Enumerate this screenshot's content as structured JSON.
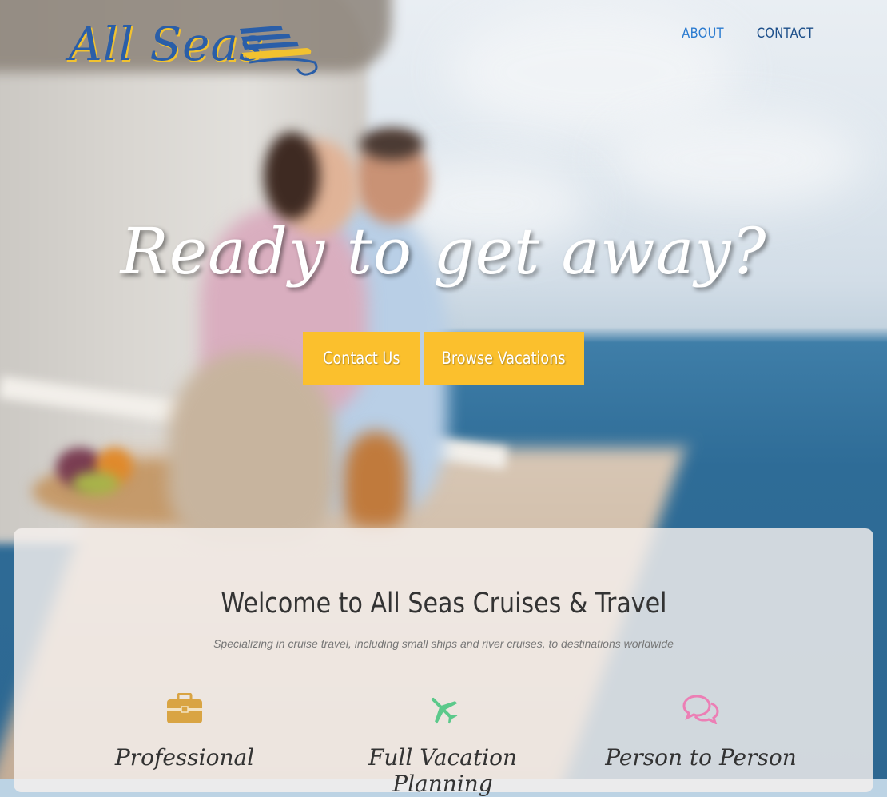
{
  "brand": {
    "logo_text": "All Seas"
  },
  "nav": {
    "items": [
      {
        "label": "ABOUT"
      },
      {
        "label": "CONTACT"
      }
    ]
  },
  "hero": {
    "headline": "Ready to get away?",
    "buttons": {
      "contact": "Contact Us",
      "browse": "Browse Vacations"
    }
  },
  "welcome": {
    "title": "Welcome to All Seas Cruises & Travel",
    "subtitle": "Specializing in cruise travel, including small ships and river cruises, to destinations worldwide",
    "features": [
      {
        "label": "Professional",
        "icon": "briefcase-icon",
        "color": "#d9a443"
      },
      {
        "label": "Full Vacation Planning",
        "icon": "airplane-icon",
        "color": "#5cc98b"
      },
      {
        "label": "Person to Person",
        "icon": "chat-bubbles-icon",
        "color": "#ec7fb5"
      }
    ]
  },
  "colors": {
    "accent": "#fbc02d",
    "nav_about": "#2a7bd0",
    "nav_contact": "#1d4f8a"
  }
}
